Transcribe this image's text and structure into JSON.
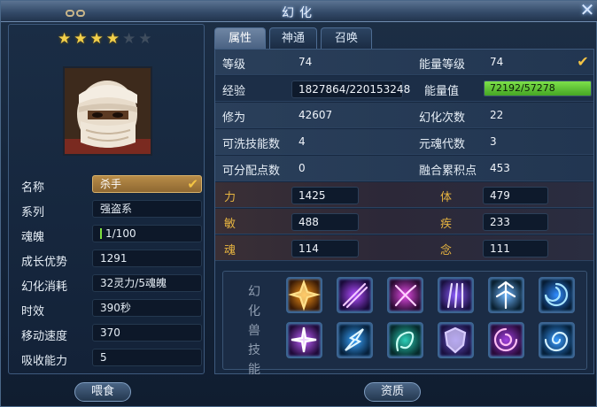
{
  "window": {
    "title": "幻化",
    "close_icon": "close-icon"
  },
  "colors": {
    "gold": "#e7b440",
    "energy_green": "#5ec232",
    "panel": "#172840"
  },
  "pet": {
    "stars_filled": 4,
    "stars_total": 6,
    "info": [
      {
        "label": "名称",
        "value": "杀手"
      },
      {
        "label": "系列",
        "value": "强盗系"
      },
      {
        "label": "魂魄",
        "value": "1/100"
      },
      {
        "label": "成长优势",
        "value": "1291"
      },
      {
        "label": "幻化消耗",
        "value": "32灵力/5魂魄"
      },
      {
        "label": "时效",
        "value": "390秒"
      },
      {
        "label": "移动速度",
        "value": "370"
      },
      {
        "label": "吸收能力",
        "value": "5"
      }
    ]
  },
  "tabs": [
    {
      "label": "属性",
      "active": true
    },
    {
      "label": "神通",
      "active": false
    },
    {
      "label": "召唤",
      "active": false
    }
  ],
  "stats": {
    "level_label": "等级",
    "level_value": "74",
    "energy_level_label": "能量等级",
    "energy_level_value": "74",
    "exp_label": "经验",
    "exp_value": "1827864/220153248",
    "energy_label": "能量值",
    "energy_value": "72192/57278",
    "energy_fill_fraction": 1.0,
    "cultivation_label": "修为",
    "cultivation_value": "42607",
    "transform_count_label": "幻化次数",
    "transform_count_value": "22",
    "wash_points_label": "可洗技能数",
    "wash_points_value": "4",
    "soul_gen_label": "元魂代数",
    "soul_gen_value": "3",
    "free_points_label": "可分配点数",
    "free_points_value": "0",
    "merge_points_label": "融合累积点",
    "merge_points_value": "453"
  },
  "attributes": [
    {
      "label": "力",
      "value": "1425"
    },
    {
      "label": "体",
      "value": "479"
    },
    {
      "label": "敏",
      "value": "488"
    },
    {
      "label": "疾",
      "value": "233"
    },
    {
      "label": "魂",
      "value": "114"
    },
    {
      "label": "念",
      "value": "111"
    }
  ],
  "skills": {
    "title": "幻化兽技能",
    "icons": [
      "fire-burst-icon",
      "purple-slash-icon",
      "pink-strike-icon",
      "violet-claw-icon",
      "trident-icon",
      "blue-vortex-icon",
      "purple-flare-icon",
      "blue-spark-icon",
      "teal-wisp-icon",
      "shadow-shield-icon",
      "violet-orb-icon",
      "spiral-icon"
    ]
  },
  "buttons": {
    "feed": "喂食",
    "aptitude": "资质"
  }
}
